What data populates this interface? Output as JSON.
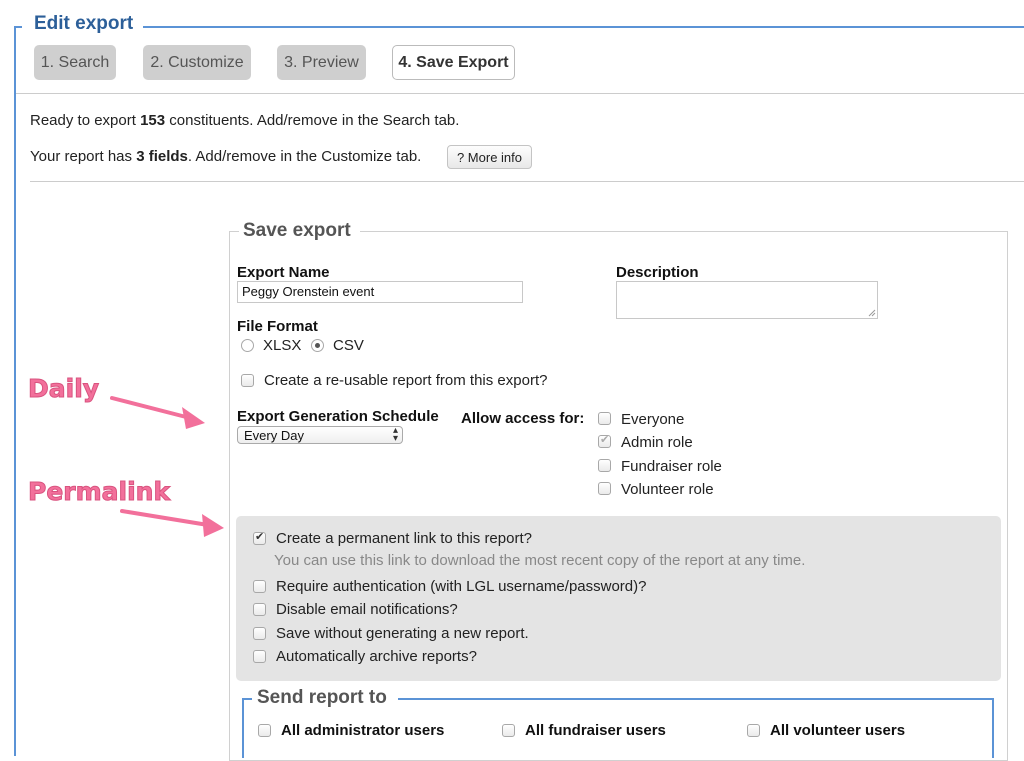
{
  "fieldset": {
    "legend": "Edit export"
  },
  "steps": [
    {
      "label": "1. Search"
    },
    {
      "label": "2. Customize"
    },
    {
      "label": "3. Preview"
    },
    {
      "label": "4. Save Export"
    }
  ],
  "summary": {
    "line1_pre": "Ready to export ",
    "count": "153",
    "line1_post": " constituents. Add/remove in the Search tab.",
    "line2_pre": "Your report has ",
    "fields": "3 fields",
    "line2_post": ". Add/remove in the Customize tab.",
    "more_info": "? More info"
  },
  "save_export": {
    "legend": "Save export",
    "export_name_label": "Export Name",
    "export_name_value": "Peggy Orenstein event",
    "description_label": "Description",
    "description_value": "",
    "file_format_label": "File Format",
    "format_xlsx": "XLSX",
    "format_csv": "CSV",
    "selected_format": "CSV",
    "reusable_label": "Create a re-usable report from this export?",
    "schedule_label": "Export Generation Schedule",
    "schedule_value": "Every Day",
    "access_label": "Allow access for:",
    "access_options": [
      {
        "label": "Everyone",
        "checked": false
      },
      {
        "label": "Admin role",
        "checked": true
      },
      {
        "label": "Fundraiser role",
        "checked": false
      },
      {
        "label": "Volunteer role",
        "checked": false
      }
    ]
  },
  "permalink_panel": {
    "permalink_label": "Create a permanent link to this report?",
    "permalink_hint": "You can use this link to download the most recent copy of the report at any time.",
    "require_auth": "Require authentication (with LGL username/password)?",
    "disable_email": "Disable email notifications?",
    "save_without": "Save without generating a new report.",
    "auto_archive": "Automatically archive reports?"
  },
  "send_report": {
    "legend": "Send report to",
    "all_admin": "All administrator users",
    "all_fundraiser": "All fundraiser users",
    "all_volunteer": "All volunteer users"
  },
  "annotations": {
    "daily": "Daily",
    "permalink": "Permalink",
    "color": "#f2709b"
  },
  "colors": {
    "accent": "#2c5f99",
    "border": "#5b93d6"
  }
}
